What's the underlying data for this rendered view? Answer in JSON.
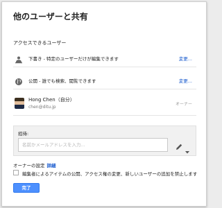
{
  "dialog": {
    "title": "他のユーザーと共有",
    "access_section_label": "アクセスできるユーザー",
    "access_rows": [
      {
        "text": "下書き - 特定のユーザーだけが編集できます",
        "link": "変更...",
        "icon": "people-icon"
      },
      {
        "text": "公開 - 誰でも検索、閲覧できます",
        "link": "変更...",
        "icon": "globe-icon"
      }
    ],
    "owner": {
      "name": "Hong Chen（自分）",
      "email": "chen@ditu.jp",
      "role": "オーナー"
    },
    "invite": {
      "label": "招待:",
      "placeholder": "名前かメールアドレスを入力...",
      "permission_icon": "pencil-icon"
    },
    "owner_settings": {
      "label": "オーナーの設定",
      "link": "詳細"
    },
    "restrict_checkbox": {
      "label": "編集者によるアイテムの公開、アクセス権の変更、新しいユーザーの追加を禁止します",
      "checked": false
    },
    "done_label": "完了"
  }
}
